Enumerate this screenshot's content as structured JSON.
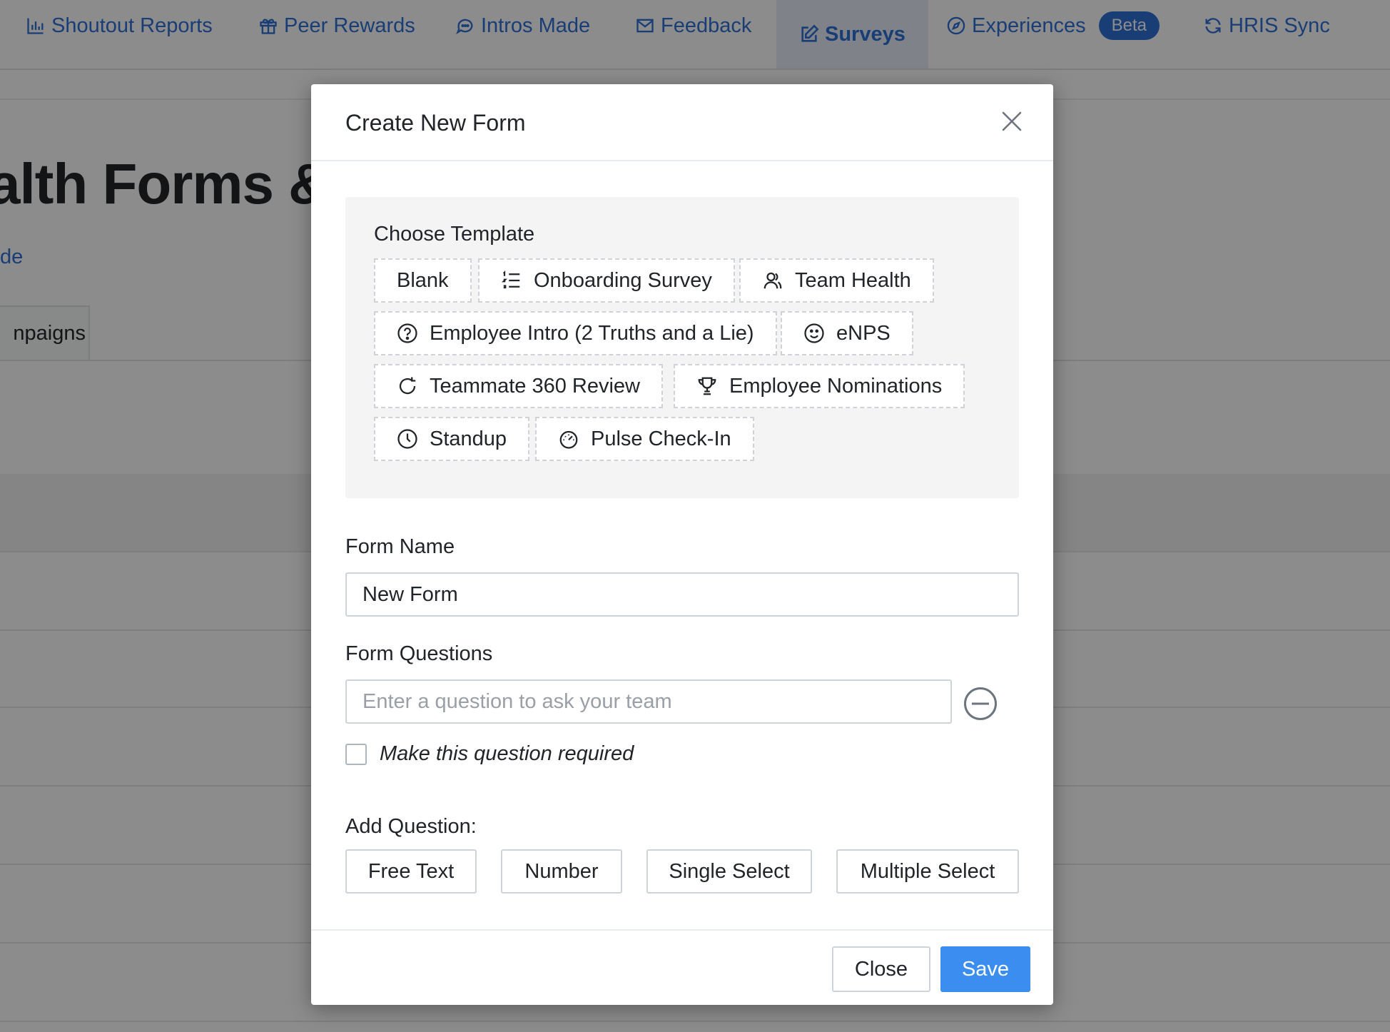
{
  "nav": {
    "items": [
      {
        "label": "Shoutout Reports",
        "icon": "bar-chart-icon"
      },
      {
        "label": "Peer Rewards",
        "icon": "gift-icon"
      },
      {
        "label": "Intros Made",
        "icon": "chat-bubbles-icon"
      },
      {
        "label": "Feedback",
        "icon": "envelope-icon"
      },
      {
        "label": "Surveys",
        "icon": "edit-icon",
        "active": true
      },
      {
        "label": "Experiences",
        "icon": "compass-icon",
        "badge": "Beta"
      },
      {
        "label": "HRIS Sync",
        "icon": "sync-icon"
      }
    ]
  },
  "background": {
    "title_fragment": "alth Forms &",
    "link_fragment": "de",
    "tab_fragment": "npaigns"
  },
  "modal": {
    "title": "Create New Form",
    "template_section_label": "Choose Template",
    "templates": [
      {
        "label": "Blank",
        "icon": ""
      },
      {
        "label": "Onboarding Survey",
        "icon": "list-icon"
      },
      {
        "label": "Team Health",
        "icon": "users-icon"
      },
      {
        "label": "Employee Intro (2 Truths and a Lie)",
        "icon": "question-circle-icon"
      },
      {
        "label": "eNPS",
        "icon": "smile-icon"
      },
      {
        "label": "Teammate 360 Review",
        "icon": "refresh-icon"
      },
      {
        "label": "Employee Nominations",
        "icon": "trophy-icon"
      },
      {
        "label": "Standup",
        "icon": "clock-icon"
      },
      {
        "label": "Pulse Check-In",
        "icon": "speedometer-icon"
      }
    ],
    "form_name_label": "Form Name",
    "form_name_value": "New Form",
    "form_questions_label": "Form Questions",
    "question_placeholder": "Enter a question to ask your team",
    "required_label": "Make this question required",
    "required_checked": false,
    "add_question_label": "Add Question:",
    "add_question_buttons": {
      "free_text": "Free Text",
      "number": "Number",
      "single_select": "Single Select",
      "multiple_select": "Multiple Select"
    },
    "close_label": "Close",
    "save_label": "Save"
  },
  "colors": {
    "link_blue": "#2f6fd6",
    "primary_button": "#3b8ef0",
    "template_panel_bg": "#f5f4f4"
  }
}
